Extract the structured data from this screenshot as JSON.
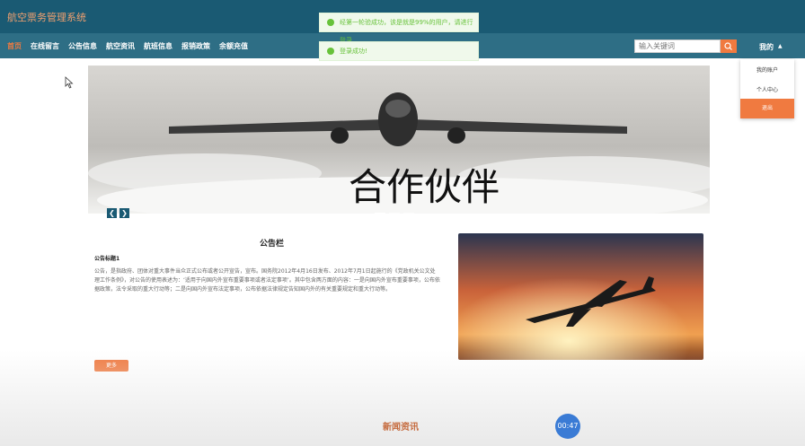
{
  "app": {
    "title": "航空票务管理系统"
  },
  "nav": {
    "items": [
      {
        "label": "首页",
        "active": true
      },
      {
        "label": "在线留言"
      },
      {
        "label": "公告信息"
      },
      {
        "label": "航空资讯"
      },
      {
        "label": "航班信息"
      },
      {
        "label": "报销政策"
      },
      {
        "label": "余额充值"
      }
    ]
  },
  "search": {
    "placeholder": "输入关键词"
  },
  "user_menu": {
    "label": "我的",
    "items": [
      "我的账户",
      "个人中心"
    ],
    "logout": "退出"
  },
  "toasts": [
    "经第一轮验成功，该是就是99%的用户，请进行登录",
    "登录成功!"
  ],
  "banner": {
    "caption": "合作伙伴"
  },
  "notice": {
    "section_title": "公告栏",
    "item_title": "公告标题1",
    "body": "公告，是指政府、团体对重大事件当众正式公布或者公开宣告，宣布。国务院2012年4月16日发布、2012年7月1日起施行的《党政机关公文处理工作条例》，对公告的使用表述为：‘适用于向国内外宣布重要事项或者法定事项’。其中包含两方面的内容：一是向国内外宣布重要事项，公布依据政策，法令采取的重大行动等；二是向国内外宣布法定事项，公布依据法律规定告知国内外的有关重要规定和重大行动等。",
    "more": "更多"
  },
  "news": {
    "section_title": "新闻资讯"
  },
  "timer": "00:47",
  "colors": {
    "header": "#1a5a73",
    "nav": "#2e6e85",
    "accent": "#f07a40"
  }
}
